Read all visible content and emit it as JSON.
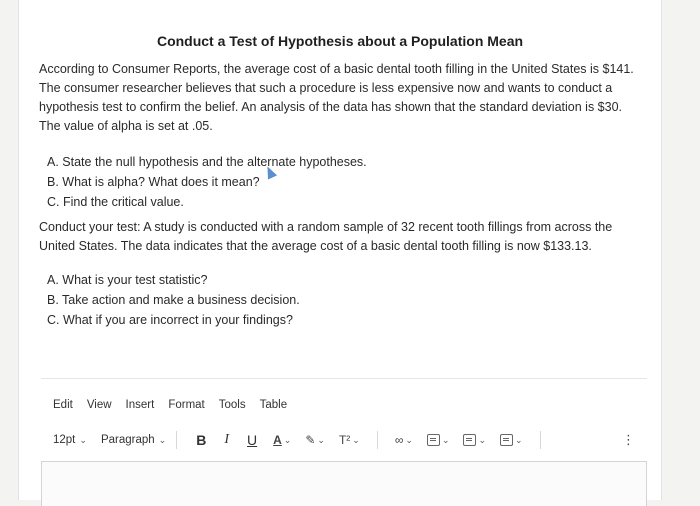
{
  "question": {
    "title": "Conduct a Test of Hypothesis about a Population Mean",
    "intro": "According to Consumer Reports, the average cost of a basic dental tooth filling in the United States is $141. The consumer researcher believes that such a procedure is less expensive now and wants to conduct a hypothesis test to confirm the belief. An analysis of the data has shown that the standard deviation is $30. The value of alpha is set at .05.",
    "part1": [
      "A. State the null hypothesis and the alternate hypotheses.",
      "B. What is alpha? What does it mean?",
      "C. Find the critical value."
    ],
    "test_text": "Conduct your test: A study is conducted with a random sample of 32 recent tooth fillings from across the United States. The data indicates that the average cost of a basic dental tooth filling is now $133.13.",
    "part2": [
      "A. What is your test statistic?",
      "B. Take action and make a business decision.",
      "C. What if you are incorrect in your findings?"
    ]
  },
  "editor": {
    "menu": [
      "Edit",
      "View",
      "Insert",
      "Format",
      "Tools",
      "Table"
    ],
    "font_size": "12pt",
    "block_format": "Paragraph",
    "bold": "B",
    "italic": "I",
    "underline": "U",
    "text_color": "A",
    "superscript": "T²",
    "more": "⋮"
  }
}
